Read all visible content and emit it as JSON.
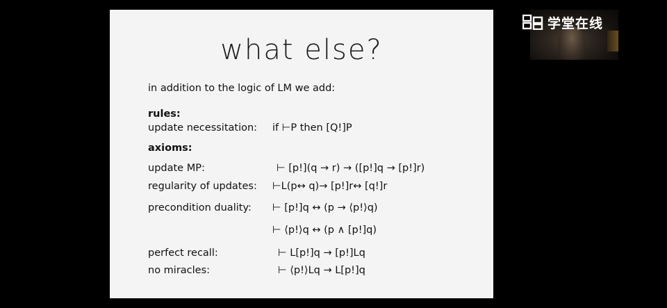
{
  "slide": {
    "title": "what else?",
    "intro": "in addition to the logic of LM we add:",
    "rules_heading": "rules:",
    "rule": {
      "label": "update necessitation:",
      "formula": "if ⊢P then  [Q!]P"
    },
    "axioms_heading": "axioms:",
    "axioms": [
      {
        "label": "update MP:",
        "formula": "⊢ [p!](q → r)  →  ([p!]q → [p!]r)"
      },
      {
        "label": "regularity of updates:",
        "formula": "⊢L(p↔ q)→ [p!]r↔ [q!]r"
      },
      {
        "label": "precondition duality:",
        "formula": "⊢ [p!]q ↔ (p → ⟨p!⟩q)"
      },
      {
        "label": "",
        "formula": "⊢ ⟨p!⟩q ↔ (p ∧ [p!]q)"
      },
      {
        "label": "perfect recall:",
        "formula": "⊢ L[p!]q → [p!]Lq"
      },
      {
        "label": "no miracles:",
        "formula": "⊢ ⟨p!⟩Lq → L[p!]q"
      }
    ]
  },
  "watermark": {
    "text": "学堂在线",
    "icon": "xuetangx-logo-icon",
    "color": "#ffffff"
  },
  "colors": {
    "background": "#000000",
    "slide": "#f4f4f4",
    "text": "#111111"
  }
}
